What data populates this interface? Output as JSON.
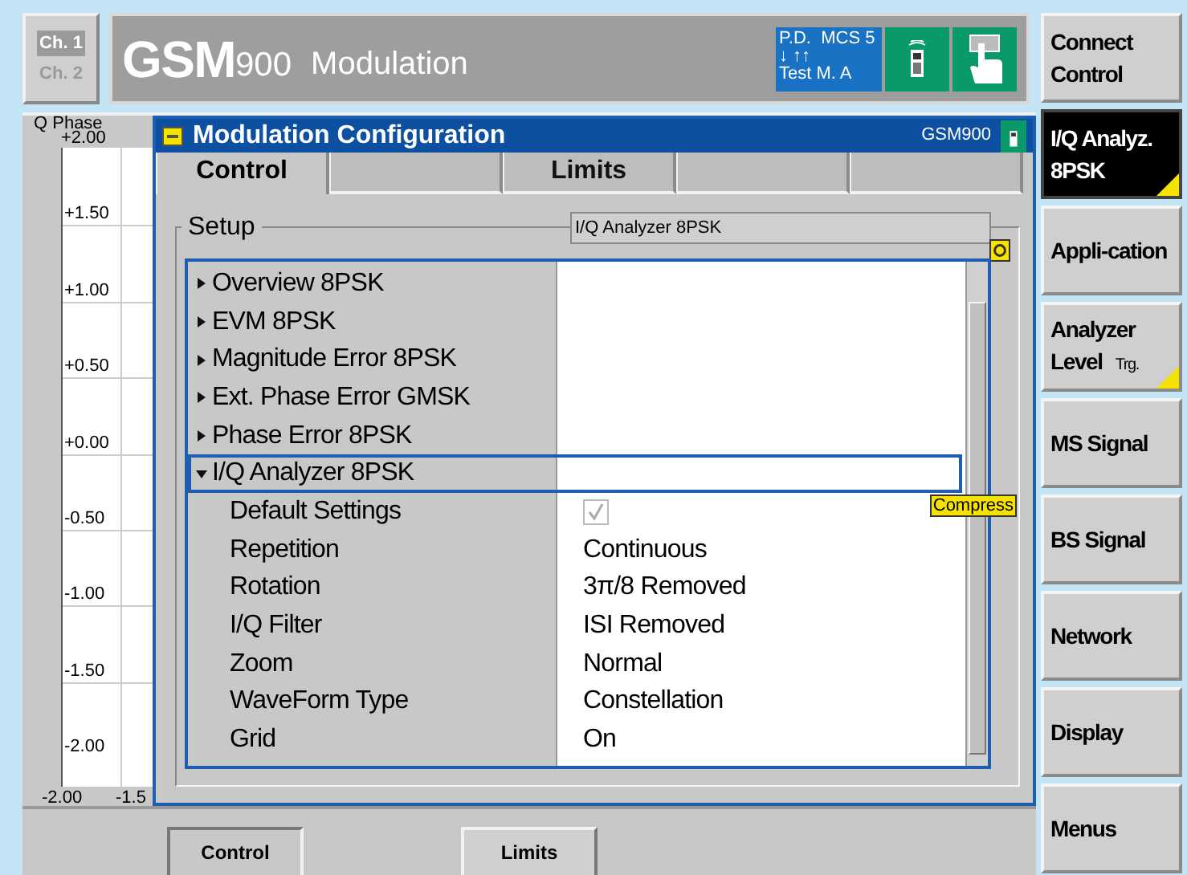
{
  "channels": [
    {
      "label": "Ch. 1",
      "selected": true
    },
    {
      "label": "Ch. 2",
      "selected": false
    }
  ],
  "header": {
    "title_main": "GSM",
    "title_band": "900",
    "title_mode": "Modulation"
  },
  "status": {
    "lines": [
      "P.D.  MCS 5",
      "↓ ↑↑",
      "Test M. A"
    ]
  },
  "chart": {
    "axis_label": "Q Phase",
    "y_ticks": [
      "+2.00",
      "+1.50",
      "+1.00",
      "+0.50",
      "+0.00",
      "-0.50",
      "-1.00",
      "-1.50",
      "-2.00"
    ],
    "x_ticks": [
      "-2.00",
      "-1.5"
    ]
  },
  "dialog": {
    "title": "Modulation Configuration",
    "standard": "GSM900",
    "tabs": [
      {
        "label": "Control",
        "selected": true
      },
      {
        "selected": false
      },
      {
        "label": "Limits",
        "selected": false
      },
      {
        "selected": false
      },
      {
        "selected": false
      }
    ],
    "group_label": "Setup",
    "setup_value": "I/Q Analyzer 8PSK",
    "compress_label": "Compress",
    "tree": [
      {
        "label": "Overview 8PSK",
        "expanded": false,
        "selected": false
      },
      {
        "label": "EVM 8PSK",
        "expanded": false,
        "selected": false
      },
      {
        "label": "Magnitude Error 8PSK",
        "expanded": false,
        "selected": false
      },
      {
        "label": "Ext. Phase Error GMSK",
        "expanded": false,
        "selected": false
      },
      {
        "label": "Phase Error 8PSK",
        "expanded": false,
        "selected": false
      },
      {
        "label": "I/Q Analyzer 8PSK",
        "expanded": true,
        "selected": true,
        "children": [
          {
            "label": "Default Settings",
            "kind": "checkbox",
            "checked": true
          },
          {
            "label": "Repetition",
            "kind": "text",
            "value": "Continuous"
          },
          {
            "label": "Rotation",
            "kind": "text",
            "value": "3π/8 Removed"
          },
          {
            "label": "I/Q Filter",
            "kind": "text",
            "value": "ISI Removed"
          },
          {
            "label": "Zoom",
            "kind": "text",
            "value": "Normal"
          },
          {
            "label": "WaveForm Type",
            "kind": "text",
            "value": "Constellation"
          },
          {
            "label": "Grid",
            "kind": "text",
            "value": "On"
          }
        ]
      }
    ]
  },
  "bottom_tabs": [
    {
      "label": "Control",
      "selected": true
    },
    {
      "label": "Limits",
      "selected": false
    }
  ],
  "softkeys": [
    {
      "label": "Connect Control",
      "selected": false,
      "corner_mark": false
    },
    {
      "label": "I/Q Analyz. 8PSK",
      "selected": true,
      "corner_mark": true
    },
    {
      "label": "Appli-cation",
      "selected": false,
      "corner_mark": false
    },
    {
      "label": "Analyzer Level",
      "sub": "Trg.",
      "selected": false,
      "corner_mark": true
    },
    {
      "label": "MS Signal",
      "selected": false,
      "corner_mark": false
    },
    {
      "label": "BS Signal",
      "selected": false,
      "corner_mark": false
    },
    {
      "label": "Network",
      "selected": false,
      "corner_mark": false
    },
    {
      "label": "Display",
      "selected": false,
      "corner_mark": false
    },
    {
      "label": "Menus",
      "selected": false,
      "corner_mark": false
    }
  ]
}
